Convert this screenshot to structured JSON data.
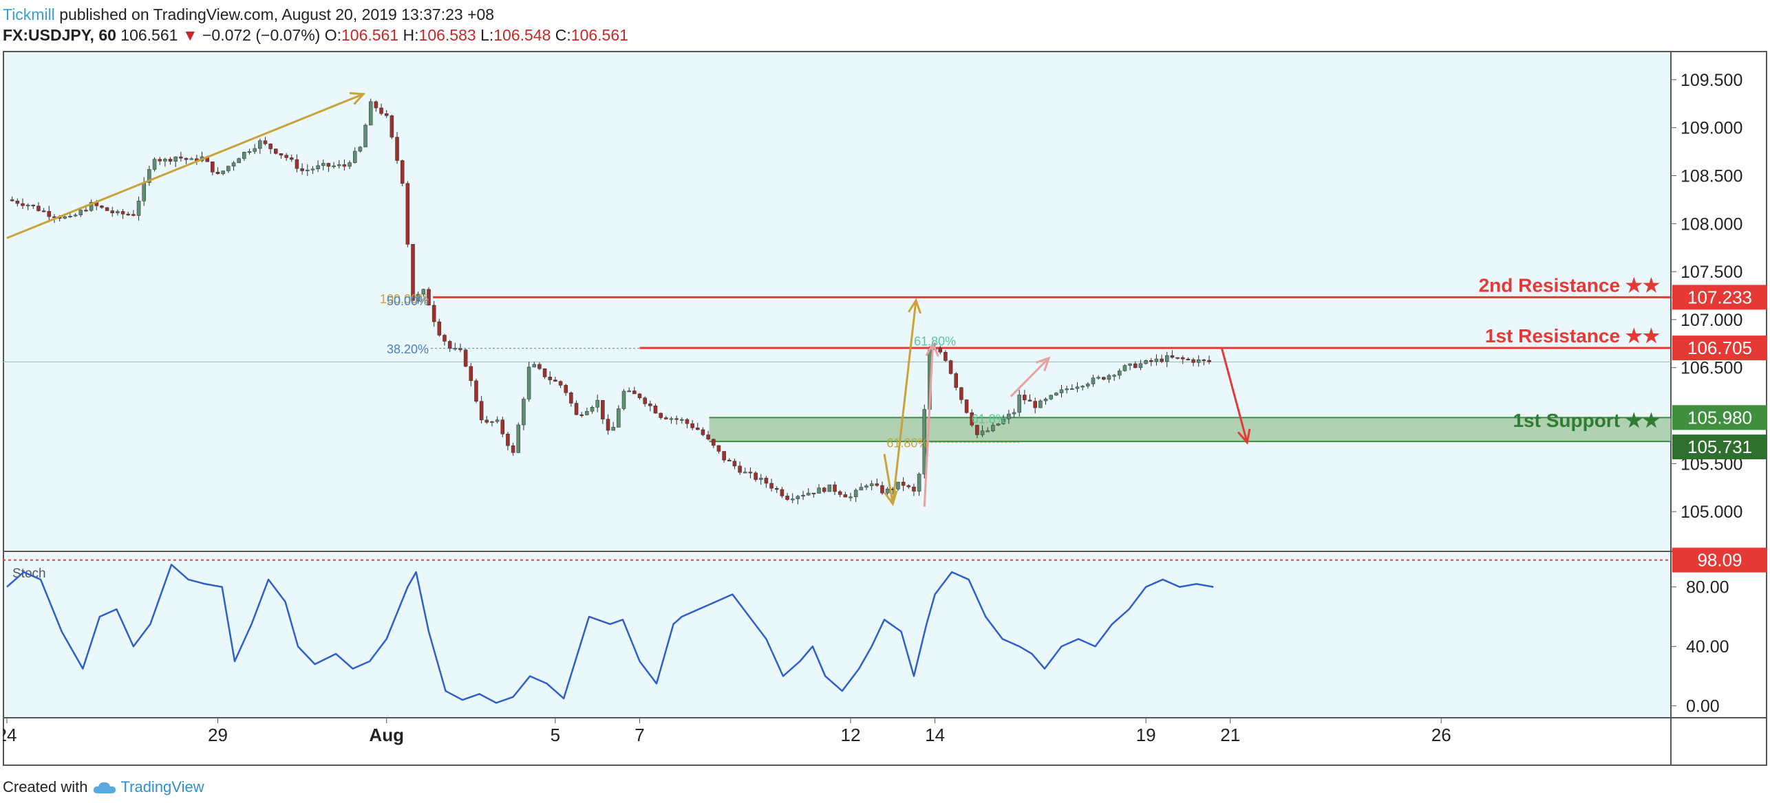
{
  "header": {
    "author": "Tickmill",
    "published": "published on TradingView.com, August 20, 2019 13:37:23 +08",
    "symbol": "FX:USDJPY, 60",
    "last": "106.561",
    "change_arrow": "▼",
    "change": "−0.072 (−0.07%)",
    "o_label": "O:",
    "o_val": "106.561",
    "h_label": "H:",
    "h_val": "106.583",
    "l_label": "L:",
    "l_val": "106.548",
    "c_label": "C:",
    "c_val": "106.561"
  },
  "footer": {
    "created_with": "Created with",
    "brand": "TradingView",
    "brand_icon": "tradingview-cloud-icon"
  },
  "colors": {
    "chart_bg": "#eaf7fb",
    "up": "#5d8f73",
    "down": "#a0302c",
    "resistance": "#e53935",
    "support": "#388e3c",
    "trend": "#c9a23a",
    "stoch": "#2e5ec8"
  },
  "chart_data": [
    {
      "type": "line",
      "title": "",
      "representation": "candlestick OHLC (hourly), approximate close path",
      "x_ticks": [
        "24",
        "29",
        "Aug",
        "5",
        "7",
        "12",
        "14",
        "19",
        "21",
        "26"
      ],
      "x_tick_index": [
        0,
        5,
        9,
        13,
        15,
        20,
        22,
        27,
        29,
        34
      ],
      "y_ticks": [
        "109.500",
        "109.000",
        "108.500",
        "108.000",
        "107.500",
        "107.000",
        "106.500",
        "105.500",
        "105.000"
      ],
      "ylim": [
        104.6,
        109.8
      ],
      "grid": false,
      "x_unit": "trading days from July 24",
      "series": [
        {
          "x": [
            0.0,
            0.5,
            1.0,
            1.5,
            2.0,
            2.6,
            3.0,
            3.5,
            3.7,
            4.0,
            4.4,
            4.6,
            5.0,
            5.5,
            6.0,
            6.6,
            7.0,
            7.5,
            8.0,
            8.4,
            8.6,
            8.8,
            9.0,
            9.4,
            9.6,
            9.9,
            10.2,
            10.5,
            10.8,
            11.3,
            11.6,
            12.0,
            12.4,
            12.8,
            13.2,
            13.5,
            14.0,
            14.3,
            14.6,
            15.0,
            15.5,
            16.0,
            16.4,
            17.0,
            17.5,
            18.0,
            18.5,
            19.0,
            19.5,
            20.0,
            20.4,
            20.8,
            21.2,
            21.5,
            21.7,
            21.8,
            21.9,
            22.2,
            22.6,
            23.0,
            23.3,
            23.6,
            23.9,
            24.0,
            24.4,
            24.8,
            25.2,
            25.6,
            26.0,
            26.5,
            27.0,
            27.5,
            28.0,
            28.5
          ],
          "values": [
            108.25,
            108.2,
            108.1,
            108.05,
            108.2,
            108.1,
            108.1,
            108.7,
            108.65,
            108.7,
            108.65,
            108.7,
            108.5,
            108.7,
            108.85,
            108.7,
            108.55,
            108.6,
            108.6,
            108.8,
            109.25,
            109.2,
            109.1,
            108.4,
            107.2,
            107.3,
            106.9,
            106.7,
            106.65,
            105.9,
            105.95,
            105.6,
            106.55,
            106.4,
            106.3,
            106.0,
            106.15,
            105.75,
            106.25,
            106.2,
            106.0,
            105.95,
            105.85,
            105.55,
            105.4,
            105.3,
            105.15,
            105.2,
            105.25,
            105.15,
            105.3,
            105.2,
            105.3,
            105.2,
            105.5,
            106.6,
            106.7,
            106.65,
            106.2,
            105.8,
            105.85,
            105.95,
            106.05,
            106.2,
            106.1,
            106.2,
            106.3,
            106.35,
            106.4,
            106.5,
            106.55,
            106.6,
            106.58,
            106.56
          ]
        }
      ],
      "levels": [
        {
          "label": "2nd Resistance ★★",
          "value": 107.233
        },
        {
          "label": "1st Resistance ★★",
          "value": 106.705
        },
        {
          "label": "1st Support ★★",
          "value": 105.98
        },
        {
          "label": "",
          "value": 105.731
        }
      ],
      "fib_labels": [
        {
          "text": "100.00%",
          "value": 107.22
        },
        {
          "text": "50.00%",
          "value": 107.2
        },
        {
          "text": "38.20%",
          "value": 106.7
        },
        {
          "text": "61.80%",
          "value": 106.78
        },
        {
          "text": "61.80%",
          "value": 105.72
        },
        {
          "text": "61.8%",
          "value": 105.97
        }
      ]
    },
    {
      "type": "line",
      "title": "Stoch",
      "y_ticks": [
        "80.00",
        "40.00",
        "0.00"
      ],
      "ylim": [
        -8,
        103
      ],
      "grid": false,
      "level": {
        "label": "98.09",
        "value": 98.09
      },
      "series": [
        {
          "x": [
            0.0,
            0.4,
            0.8,
            1.3,
            1.8,
            2.2,
            2.6,
            3.0,
            3.4,
            3.9,
            4.3,
            4.7,
            5.1,
            5.4,
            5.8,
            6.2,
            6.6,
            6.9,
            7.3,
            7.8,
            8.2,
            8.6,
            9.0,
            9.5,
            9.7,
            10.0,
            10.4,
            10.8,
            11.2,
            11.6,
            12.0,
            12.4,
            12.8,
            13.2,
            13.8,
            14.3,
            14.6,
            15.0,
            15.4,
            15.8,
            16.0,
            16.4,
            16.8,
            17.2,
            17.6,
            18.0,
            18.4,
            18.8,
            19.1,
            19.4,
            19.8,
            20.2,
            20.5,
            20.8,
            21.2,
            21.5,
            21.8,
            22.0,
            22.4,
            22.8,
            23.2,
            23.6,
            24.0,
            24.3,
            24.6,
            25.0,
            25.4,
            25.8,
            26.2,
            26.6,
            27.0,
            27.4,
            27.8,
            28.2,
            28.6
          ],
          "values": [
            80,
            90,
            85,
            50,
            25,
            60,
            65,
            40,
            55,
            95,
            85,
            82,
            80,
            30,
            55,
            85,
            70,
            40,
            28,
            35,
            25,
            30,
            45,
            80,
            90,
            50,
            10,
            4,
            8,
            2,
            6,
            20,
            15,
            5,
            60,
            55,
            58,
            30,
            15,
            55,
            60,
            65,
            70,
            75,
            60,
            45,
            20,
            30,
            40,
            20,
            10,
            25,
            40,
            58,
            50,
            20,
            55,
            75,
            90,
            85,
            60,
            45,
            40,
            35,
            25,
            40,
            45,
            40,
            55,
            65,
            80,
            85,
            80,
            82,
            80
          ]
        }
      ]
    }
  ]
}
